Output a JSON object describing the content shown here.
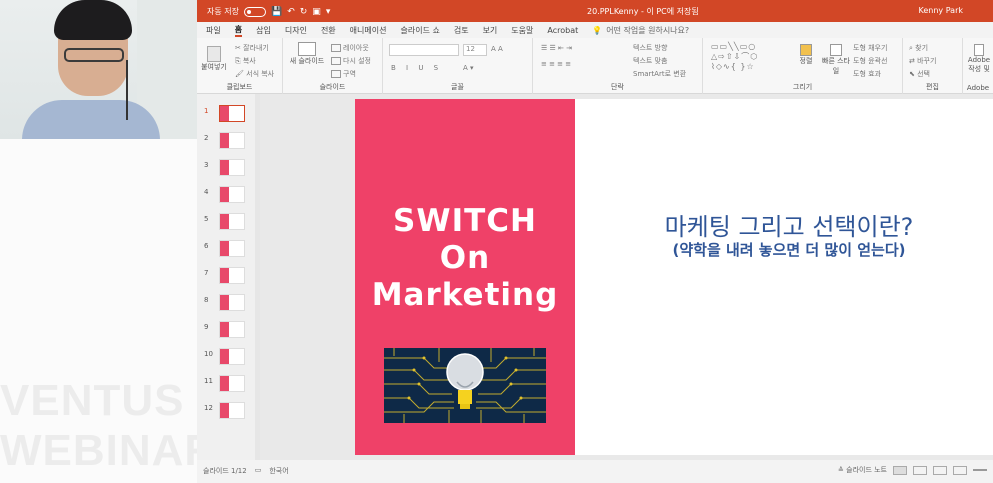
{
  "window": {
    "title": "20.PPLKenny - 이 PC에 저장됨",
    "user": "Kenny Park",
    "autosave_label": "자동 저장"
  },
  "menu": {
    "items": [
      "파일",
      "홈",
      "삽입",
      "디자인",
      "전환",
      "애니메이션",
      "슬라이드 쇼",
      "검토",
      "보기",
      "도움말",
      "Acrobat"
    ],
    "tellme": "어떤 작업을 원하시나요?"
  },
  "ribbon": {
    "clipboard": {
      "paste": "붙여넣기",
      "cut": "잘라내기",
      "copy": "복사",
      "format": "서식 복사",
      "label": "클립보드"
    },
    "slides": {
      "new": "새 슬라이드",
      "layout": "레이아웃",
      "reset": "다시 설정",
      "section": "구역",
      "label": "슬라이드"
    },
    "font": {
      "size": "12",
      "label": "글꼴"
    },
    "paragraph": {
      "direction": "텍스트 방향",
      "align": "텍스트 맞춤",
      "smartart": "SmartArt로 변환",
      "label": "단락"
    },
    "drawing": {
      "arrange": "정렬",
      "styles": "빠른 스타일",
      "fill": "도형 채우기",
      "outline": "도형 윤곽선",
      "effects": "도형 효과",
      "label": "그리기"
    },
    "editing": {
      "find": "찾기",
      "replace": "바꾸기",
      "select": "선택",
      "label": "편집"
    },
    "adobe": {
      "label": "Adobe",
      "item": "Adobe 작성 및"
    }
  },
  "thumbnails": [
    "1",
    "2",
    "3",
    "4",
    "5",
    "6",
    "7",
    "8",
    "9",
    "10",
    "11",
    "12"
  ],
  "slide": {
    "title_lines": [
      "SWITCH",
      "On",
      "Marketing"
    ],
    "heading": "마케팅 그리고 선택이란?",
    "subheading": "(약학을 내려 놓으면 더 많이 얻는다)"
  },
  "watermark": [
    "VENTUS",
    "WEBINAR"
  ],
  "status": {
    "slide_count": "슬라이드 1/12",
    "language": "한국어",
    "notes": "슬라이드 노트"
  },
  "colors": {
    "title_bar": "#d24726",
    "slide_panel": "#ef4168",
    "heading": "#2f5597"
  }
}
